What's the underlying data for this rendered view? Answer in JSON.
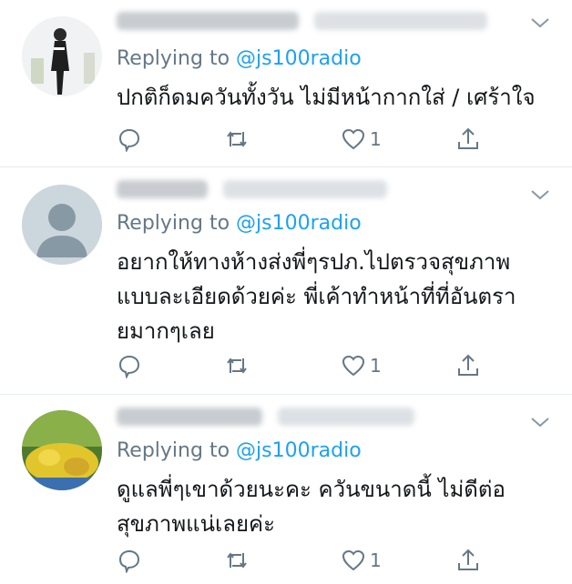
{
  "tweets": [
    {
      "reply_prefix": "Replying to ",
      "reply_handle": "@js100radio",
      "text": "ปกติก็ดมควันทั้งวัน ไม่มีหน้ากากใส่ / เศร้าใจ",
      "like_count": "1"
    },
    {
      "reply_prefix": "Replying to ",
      "reply_handle": "@js100radio",
      "text": "อยากให้ทางห้างส่งพี่ๆรปภ.ไปตรวจสุขภาพแบบละเอียดด้วยค่ะ พี่เค้าทำหน้าที่ที่อันตรายมากๆเลย",
      "like_count": "1"
    },
    {
      "reply_prefix": "Replying to ",
      "reply_handle": "@js100radio",
      "text": "ดูแลพี่ๆเขาด้วยนะคะ ควันขนาดนี้ ไม่ดีต่อสุขภาพแน่เลยค่ะ",
      "like_count": "1"
    }
  ],
  "colors": {
    "link": "#1da1f2",
    "muted": "#657786",
    "text": "#14171a",
    "divider": "#e6ecf0"
  },
  "icons": [
    "reply-icon",
    "retweet-icon",
    "like-icon",
    "share-icon",
    "chevron-down-icon"
  ]
}
